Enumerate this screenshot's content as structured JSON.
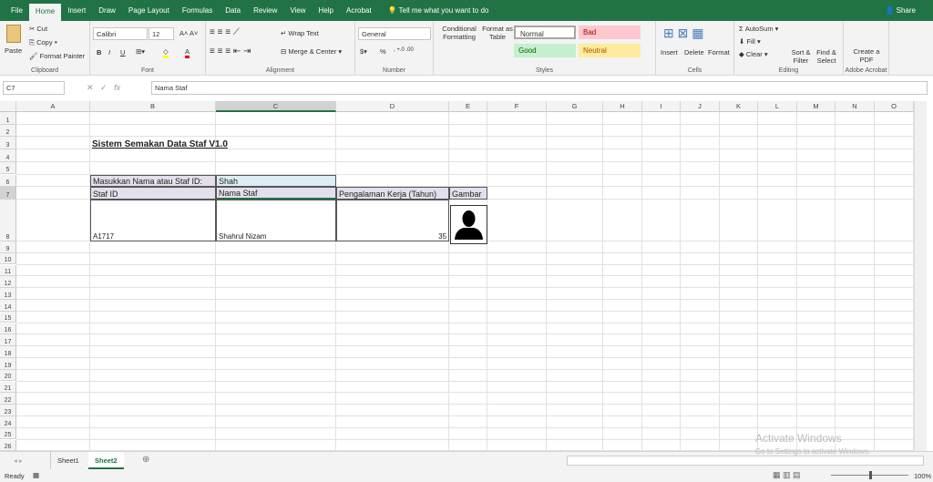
{
  "ribbon_tabs": [
    "File",
    "Home",
    "Insert",
    "Draw",
    "Page Layout",
    "Formulas",
    "Data",
    "Review",
    "View",
    "Help",
    "Acrobat"
  ],
  "active_tab": "Home",
  "tell_me": "Tell me what you want to do",
  "share": "Share",
  "clipboard": {
    "paste": "Paste",
    "cut": "Cut",
    "copy": "Copy",
    "format_painter": "Format Painter",
    "label": "Clipboard"
  },
  "font": {
    "name": "Calibri",
    "size": "12",
    "label": "Font",
    "bold": "B",
    "italic": "I",
    "underline": "U"
  },
  "alignment": {
    "wrap": "Wrap Text",
    "merge": "Merge & Center",
    "label": "Alignment"
  },
  "number": {
    "format": "General",
    "label": "Number",
    "percent": "%"
  },
  "styles": {
    "conditional": "Conditional Formatting",
    "format_table": "Format as Table",
    "normal": "Normal",
    "bad": "Bad",
    "good": "Good",
    "neutral": "Neutral",
    "label": "Styles"
  },
  "cells": {
    "insert": "Insert",
    "delete": "Delete",
    "format": "Format",
    "label": "Cells"
  },
  "editing": {
    "autosum": "AutoSum",
    "fill": "Fill",
    "clear": "Clear",
    "sort": "Sort & Filter",
    "find": "Find & Select",
    "label": "Editing"
  },
  "acrobat": {
    "create": "Create a PDF",
    "label": "Adobe Acrobat"
  },
  "formula_bar": {
    "name_box": "C7",
    "formula": "Nama Staf"
  },
  "columns": [
    "A",
    "B",
    "C",
    "D",
    "E",
    "F",
    "G",
    "H",
    "I",
    "J",
    "K",
    "L",
    "M",
    "N",
    "O"
  ],
  "selected_column": "C",
  "selected_row": 7,
  "sheet": {
    "title": "Sistem Semakan Data Staf V1.0",
    "search_label": "Masukkan Nama atau Staf ID:",
    "search_value": "Shah",
    "headers": [
      "Staf ID",
      "Nama Staf",
      "Pengalaman Kerja (Tahun)",
      "Gambar"
    ],
    "row": {
      "id": "A1717",
      "name": "Shahrul Nizam",
      "experience": "35"
    }
  },
  "sheet_tabs": [
    "Sheet1",
    "Sheet2"
  ],
  "active_sheet": "Sheet2",
  "status": {
    "ready": "Ready",
    "zoom": "100%"
  },
  "watermark": {
    "line1": "Activate Windows",
    "line2": "Go to Settings to activate Windows."
  },
  "colors": {
    "brand": "#217346",
    "header_fill": "#e4dfec",
    "input_fill": "#daeef3"
  }
}
